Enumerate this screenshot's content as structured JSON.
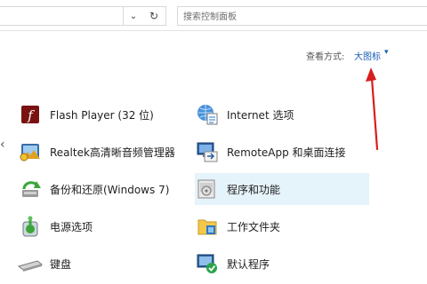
{
  "search": {
    "placeholder": "搜索控制面板"
  },
  "view": {
    "label": "查看方式:",
    "value": "大图标"
  },
  "items_left": [
    {
      "label": "Flash Player (32 位)",
      "icon": "flash-player-icon"
    },
    {
      "label": "Realtek高清晰音频管理器",
      "icon": "realtek-audio-icon"
    },
    {
      "label": "备份和还原(Windows 7)",
      "icon": "backup-restore-icon"
    },
    {
      "label": "电源选项",
      "icon": "power-options-icon"
    },
    {
      "label": "键盘",
      "icon": "keyboard-icon"
    }
  ],
  "items_right": [
    {
      "label": "Internet 选项",
      "icon": "internet-options-icon"
    },
    {
      "label": "RemoteApp 和桌面连接",
      "icon": "remoteapp-icon"
    },
    {
      "label": "程序和功能",
      "icon": "programs-features-icon",
      "selected": true
    },
    {
      "label": "工作文件夹",
      "icon": "work-folders-icon"
    },
    {
      "label": "默认程序",
      "icon": "default-programs-icon"
    }
  ],
  "colors": {
    "accent": "#1a5fb4",
    "selected_bg": "#e5f3fb",
    "arrow": "#d81e1e"
  }
}
